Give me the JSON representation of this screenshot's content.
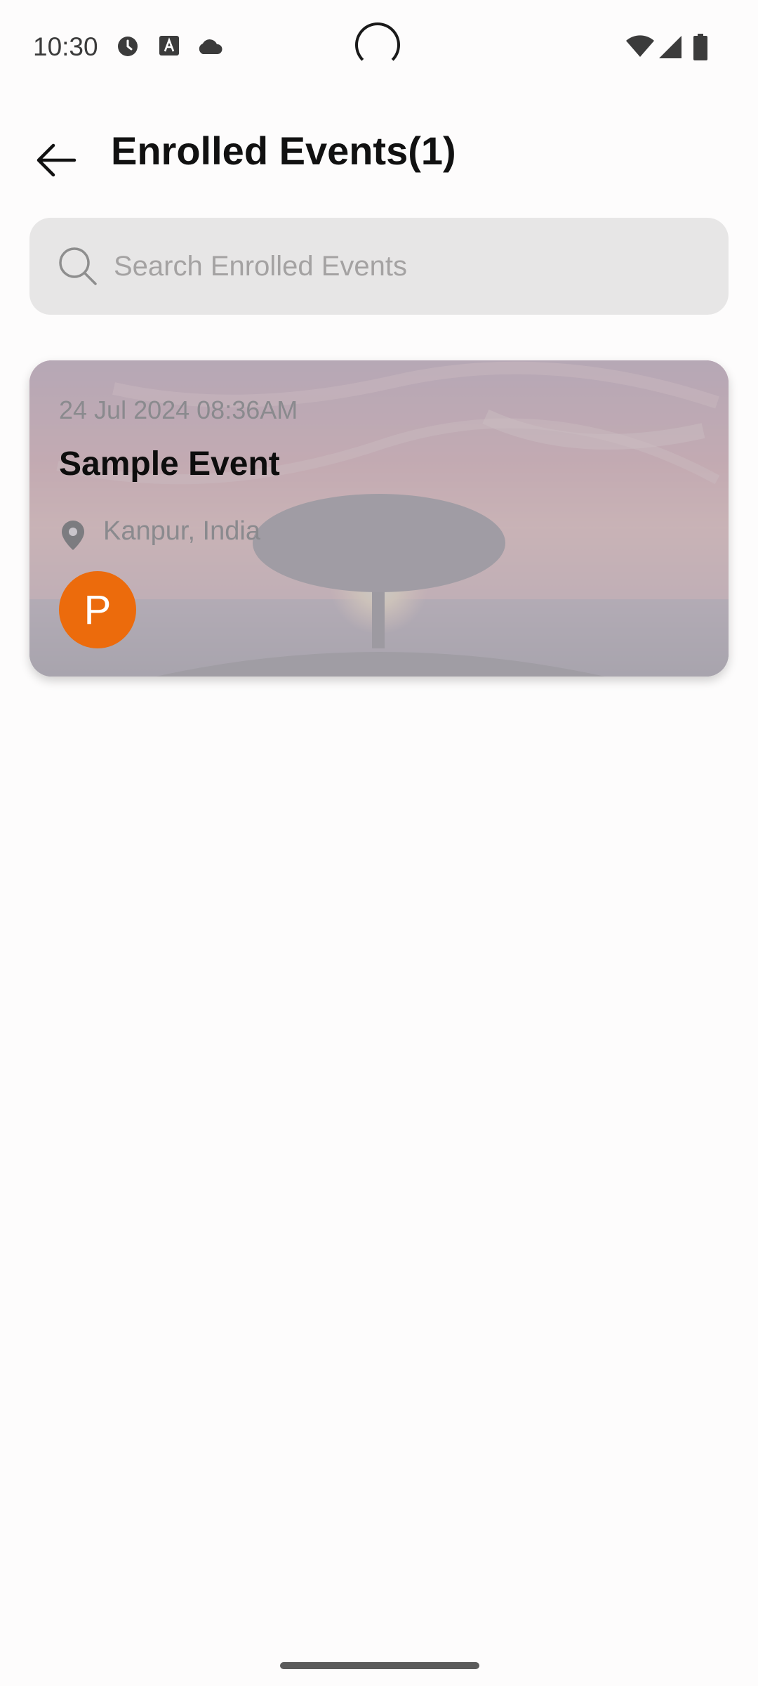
{
  "status_bar": {
    "time": "10:30",
    "icons": [
      "clock-icon",
      "text-a-icon",
      "cloud-icon",
      "wifi-icon",
      "signal-icon",
      "battery-icon"
    ]
  },
  "header": {
    "title": "Enrolled Events(1)",
    "back_icon": "arrow-back-icon"
  },
  "search": {
    "placeholder": "Search Enrolled Events",
    "value": ""
  },
  "events": [
    {
      "date": "24 Jul 2024 08:36AM",
      "title": "Sample Event",
      "location": "Kanpur, India",
      "avatar_initial": "P",
      "avatar_color": "#ec6b0c"
    }
  ],
  "colors": {
    "background": "#fdfcfc",
    "search_bg": "#e7e6e6",
    "accent": "#ec6b0c"
  }
}
